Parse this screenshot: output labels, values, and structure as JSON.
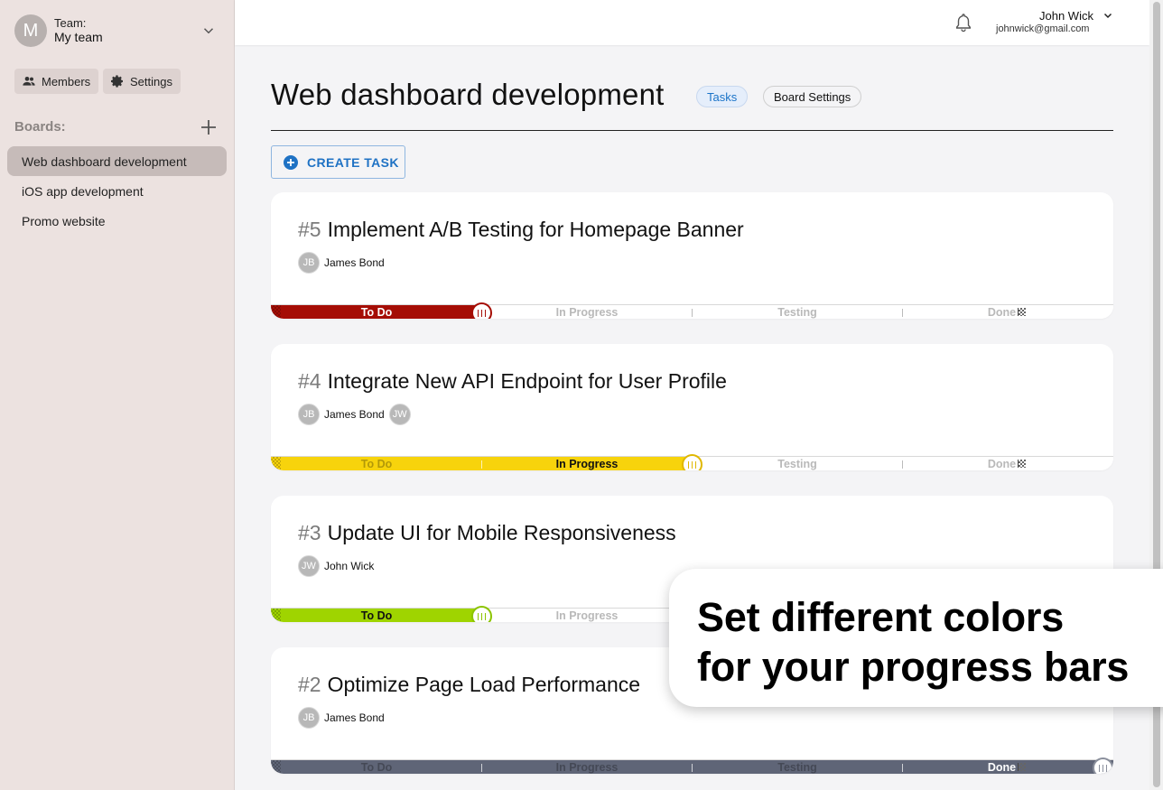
{
  "team": {
    "avatar_letter": "M",
    "label": "Team:",
    "name": "My team"
  },
  "sidebar": {
    "members_label": "Members",
    "settings_label": "Settings",
    "boards_label": "Boards:",
    "boards": [
      {
        "label": "Web dashboard development",
        "active": true
      },
      {
        "label": "iOS app development",
        "active": false
      },
      {
        "label": "Promo website",
        "active": false
      }
    ]
  },
  "topbar": {
    "user_name": "John Wick",
    "user_email": "johnwick@gmail.com"
  },
  "main": {
    "title": "Web dashboard development",
    "tab_tasks": "Tasks",
    "tab_board_settings": "Board Settings",
    "create_task_label": "CREATE TASK"
  },
  "stages": [
    "To Do",
    "In Progress",
    "Testing",
    "Done"
  ],
  "tasks": [
    {
      "number": "#5",
      "title": "Implement A/B Testing for Homepage Banner",
      "assignees": [
        {
          "initials": "JB",
          "name": "James Bond"
        }
      ],
      "progress_stage": 1,
      "bar_color": "#a50d05",
      "knob_color": "#a50d05",
      "active_text_color": "#ffffff"
    },
    {
      "number": "#4",
      "title": "Integrate New API Endpoint for User Profile",
      "assignees": [
        {
          "initials": "JB",
          "name": "James Bond"
        },
        {
          "initials": "JW",
          "name": ""
        }
      ],
      "progress_stage": 2,
      "bar_color": "#f7d30c",
      "knob_color": "#e0b800",
      "active_text_color": "#111111"
    },
    {
      "number": "#3",
      "title": "Update UI for Mobile Responsiveness",
      "assignees": [
        {
          "initials": "JW",
          "name": "John Wick"
        }
      ],
      "progress_stage": 1,
      "bar_color": "#9fd400",
      "knob_color": "#8bc400",
      "active_text_color": "#111111"
    },
    {
      "number": "#2",
      "title": "Optimize Page Load Performance",
      "assignees": [
        {
          "initials": "JB",
          "name": "James Bond"
        }
      ],
      "progress_stage": 4,
      "bar_color": "#5f6577",
      "knob_color": "#8a8f9c",
      "active_text_color": "#ffffff"
    }
  ],
  "callout": {
    "text": "Set different colors\nfor your progress bars"
  }
}
